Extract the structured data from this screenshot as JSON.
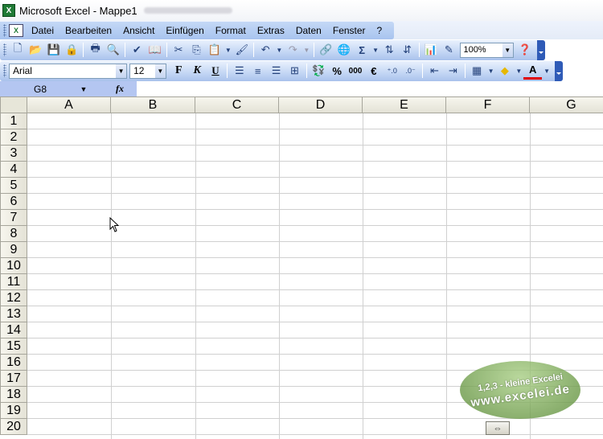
{
  "window": {
    "title": "Microsoft Excel - Mappe1"
  },
  "menu": {
    "items": [
      {
        "label": "Datei"
      },
      {
        "label": "Bearbeiten"
      },
      {
        "label": "Ansicht"
      },
      {
        "label": "Einfügen"
      },
      {
        "label": "Format"
      },
      {
        "label": "Extras"
      },
      {
        "label": "Daten"
      },
      {
        "label": "Fenster"
      },
      {
        "label": "?"
      }
    ]
  },
  "toolbar_standard": {
    "zoom": "100%",
    "icons": [
      "new-icon",
      "open-icon",
      "save-icon",
      "permission-icon",
      "print-icon",
      "print-preview-icon",
      "spelling-icon",
      "research-icon",
      "cut-icon",
      "copy-icon",
      "paste-icon",
      "format-painter-icon",
      "undo-icon",
      "redo-icon",
      "hyperlink-icon",
      "web-icon",
      "autosum-icon",
      "sort-asc-icon",
      "sort-desc-icon",
      "chart-wizard-icon",
      "drawing-icon",
      "help-icon"
    ]
  },
  "toolbar_format": {
    "font": "Arial",
    "size": "12",
    "bold": "F",
    "italic": "K",
    "underline": "U",
    "percent": "%",
    "thousands": "000",
    "euro": "€",
    "font_color_letter": "A"
  },
  "formula_bar": {
    "name_box": "G8",
    "fx": "fx",
    "formula": ""
  },
  "sheet": {
    "columns": [
      "A",
      "B",
      "C",
      "D",
      "E",
      "F",
      "G"
    ],
    "rows": [
      "1",
      "2",
      "3",
      "4",
      "5",
      "6",
      "7",
      "8",
      "9",
      "10",
      "11",
      "12",
      "13",
      "14",
      "15",
      "16",
      "17",
      "18",
      "19",
      "20"
    ]
  },
  "logo": {
    "line1": "1,2,3 - kleine Excelei",
    "line2": "www.excelei.de"
  },
  "colors": {
    "menu_bg": "#a8c4ef",
    "toolbar_end": "#2f5bb7",
    "namebox_bg": "#b4c6f1",
    "header_bg": "#e4e2d6"
  }
}
